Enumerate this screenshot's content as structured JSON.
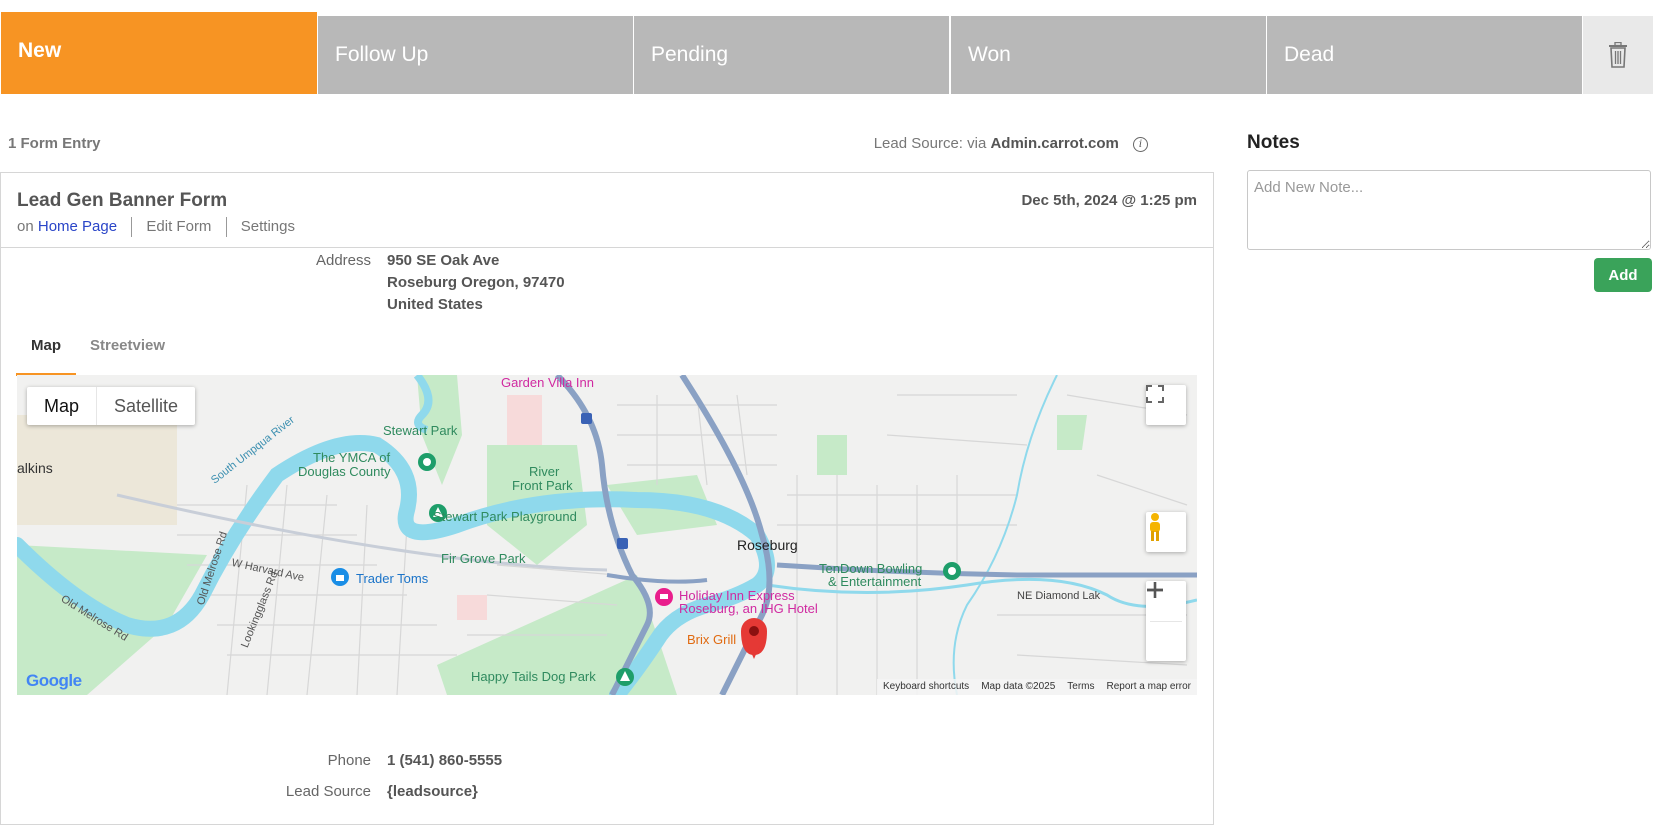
{
  "pipeline": {
    "stages": [
      {
        "label": "New",
        "active": true
      },
      {
        "label": "Follow Up",
        "active": false
      },
      {
        "label": "Pending",
        "active": false
      },
      {
        "label": "Won",
        "active": false
      },
      {
        "label": "Dead",
        "active": false
      }
    ],
    "active_color": "#f79423",
    "inactive_color": "#b8b8b8",
    "trash_icon": "trash-icon"
  },
  "entries": {
    "count_label": "1 Form Entry",
    "lead_source_prefix": "Lead Source: via",
    "lead_source_value": "Admin.carrot.com",
    "info_icon": "info-icon"
  },
  "form": {
    "title": "Lead Gen Banner Form",
    "on_prefix": "on",
    "page_link": "Home Page",
    "edit_link": "Edit Form",
    "settings_link": "Settings",
    "date": "Dec 5th, 2024 @ 1:25 pm"
  },
  "fields": {
    "address_label": "Address",
    "address_line1": "950 SE Oak Ave",
    "address_line2": "Roseburg Oregon, 97470",
    "address_line3": "United States",
    "phone_label": "Phone",
    "phone_value": "1 (541) 860-5555",
    "lead_source_label": "Lead Source",
    "lead_source_value": "{leadsource}"
  },
  "map_tabs": {
    "map": "Map",
    "streetview": "Streetview"
  },
  "map": {
    "type_map": "Map",
    "type_satellite": "Satellite",
    "logo": "Google",
    "footer": {
      "shortcuts": "Keyboard shortcuts",
      "data": "Map data ©2025",
      "terms": "Terms",
      "report": "Report a map error"
    },
    "labels": {
      "garden_villa": "Garden Villa Inn",
      "stewart_park": "Stewart Park",
      "ymca_1": "The YMCA of",
      "ymca_2": "Douglas County",
      "river_front_1": "River",
      "river_front_2": "Front Park",
      "calkins": "alkins",
      "umpqua": "South Umpqua River",
      "playground": "Stewart Park Playground",
      "roseburg": "Roseburg",
      "tendown_1": "TenDown Bowling",
      "tendown_2": "& Entertainment",
      "fir_grove": "Fir Grove Park",
      "harvard": "W Harvard Ave",
      "trader": "Trader Toms",
      "holiday_1": "Holiday Inn Express",
      "holiday_2": "Roseburg, an IHG Hotel",
      "diamond": "NE Diamond Lak",
      "brix": "Brix Grill",
      "melrose_1": "Old Melrose Rd",
      "melrose_2": "Old Melrose Rd",
      "lookingglass": "Lookingglass Rd",
      "happy": "Happy Tails Dog Park",
      "i5": "5"
    },
    "colors": {
      "land": "#f1f1f0",
      "water": "#8fd9ec",
      "park": "#c6eac8",
      "highway": "#8aa1c4",
      "pin": "#e53935"
    }
  },
  "notes": {
    "title": "Notes",
    "placeholder": "Add New Note...",
    "add_button": "Add"
  }
}
